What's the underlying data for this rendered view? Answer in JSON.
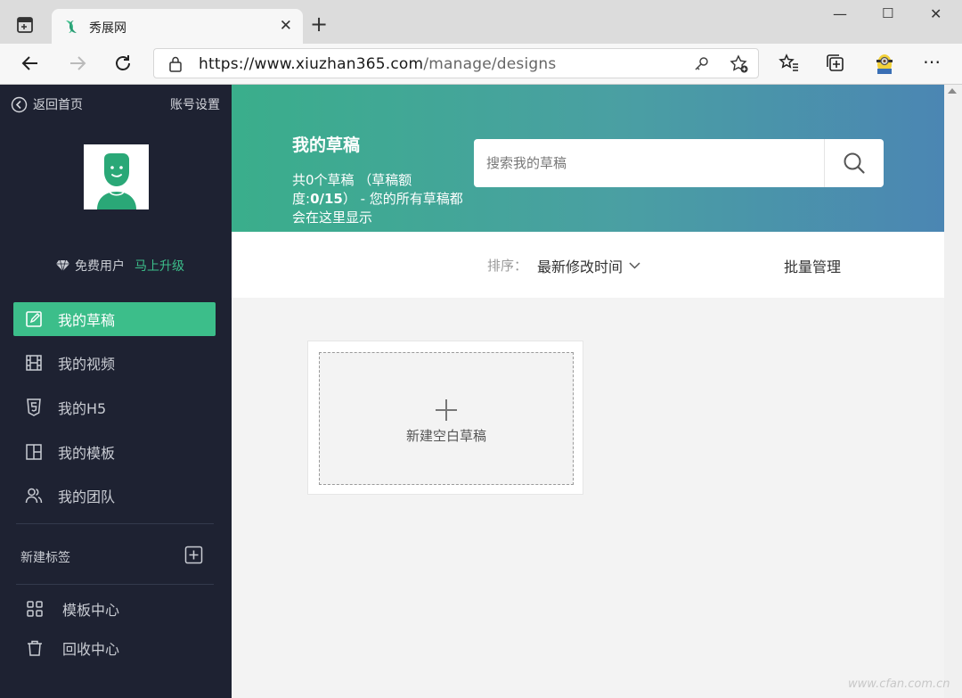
{
  "browser": {
    "tab_title": "秀展网",
    "url_main": "https://www.xiuzhan365.com",
    "url_path": "/manage/designs"
  },
  "sidebar": {
    "back_label": "返回首页",
    "account_label": "账号设置",
    "plan_label": "免费用户",
    "upgrade_label": "马上升级",
    "items": [
      {
        "label": "我的草稿",
        "icon": "edit-icon",
        "active": true
      },
      {
        "label": "我的视频",
        "icon": "film-icon"
      },
      {
        "label": "我的H5",
        "icon": "html5-icon"
      },
      {
        "label": "我的模板",
        "icon": "template-icon"
      },
      {
        "label": "我的团队",
        "icon": "team-icon"
      }
    ],
    "new_tag_label": "新建标签",
    "bottom_items": [
      {
        "label": "模板中心",
        "icon": "grid-icon"
      },
      {
        "label": "回收中心",
        "icon": "trash-icon"
      }
    ]
  },
  "hero": {
    "title": "我的草稿",
    "sub_1": "共0个草稿 （草稿额度:",
    "sub_quota": "0/15",
    "sub_2": "） - 您的所有草稿都会在这里显示"
  },
  "search": {
    "placeholder": "搜索我的草稿"
  },
  "toolbar": {
    "sort_label": "排序：",
    "sort_value": "最新修改时间",
    "batch_label": "批量管理"
  },
  "card": {
    "new_label": "新建空白草稿"
  },
  "watermark": "www.cfan.com.cn",
  "colors": {
    "sidebar_bg": "#1e2232",
    "accent": "#3cbe8a",
    "hero_start": "#3aae8b",
    "hero_end": "#4b86b3"
  }
}
